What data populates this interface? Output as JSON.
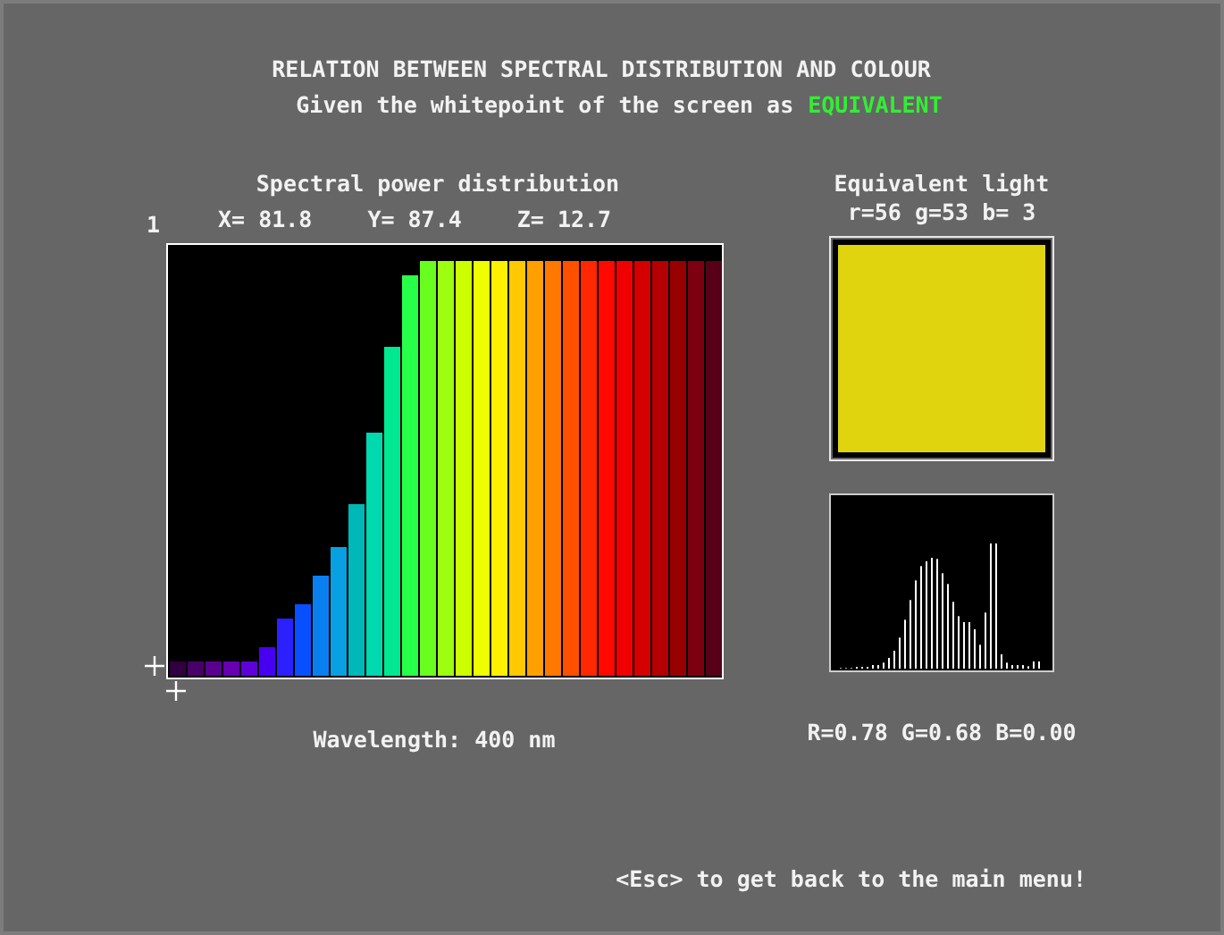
{
  "title": "RELATION BETWEEN SPECTRAL DISTRIBUTION AND COLOUR",
  "subtitle": {
    "text": "Given the whitepoint of the screen as",
    "mode": "EQUIVALENT"
  },
  "spectrum": {
    "heading": "Spectral power distribution",
    "index": "1",
    "readings": [
      "X= 81.8",
      "Y= 87.4",
      "Z= 12.7"
    ],
    "wavelength": "Wavelength: 400 nm"
  },
  "equivalent": {
    "heading": "Equivalent light",
    "rgb_bytes": "r=56 g=53 b= 3",
    "color": "#e0d40e",
    "rgb_fractions": "R=0.78 G=0.68 B=0.00"
  },
  "footer": "<Esc> to get back to the main menu!"
}
